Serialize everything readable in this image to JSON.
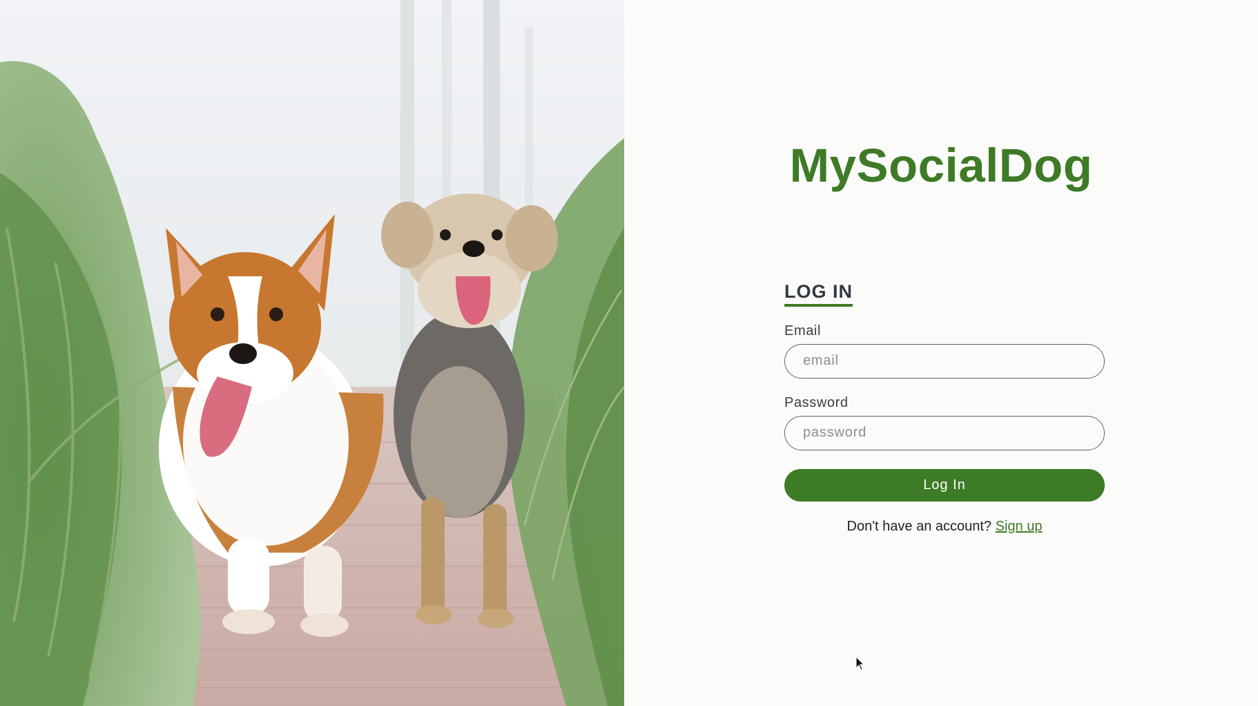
{
  "brand": {
    "title": "MySocialDog"
  },
  "login": {
    "heading": "LOG IN",
    "email": {
      "label": "Email",
      "placeholder": "email",
      "value": ""
    },
    "password": {
      "label": "Password",
      "placeholder": "password",
      "value": ""
    },
    "submit_label": "Log In",
    "signup_prompt": "Don't have an account?",
    "signup_link": "Sign up"
  },
  "colors": {
    "accent": "#3f7a26",
    "button": "#3e7b27",
    "heading": "#2f3a40",
    "background": "#fbfbfa"
  },
  "hero": {
    "icon": "dogs-photo"
  }
}
